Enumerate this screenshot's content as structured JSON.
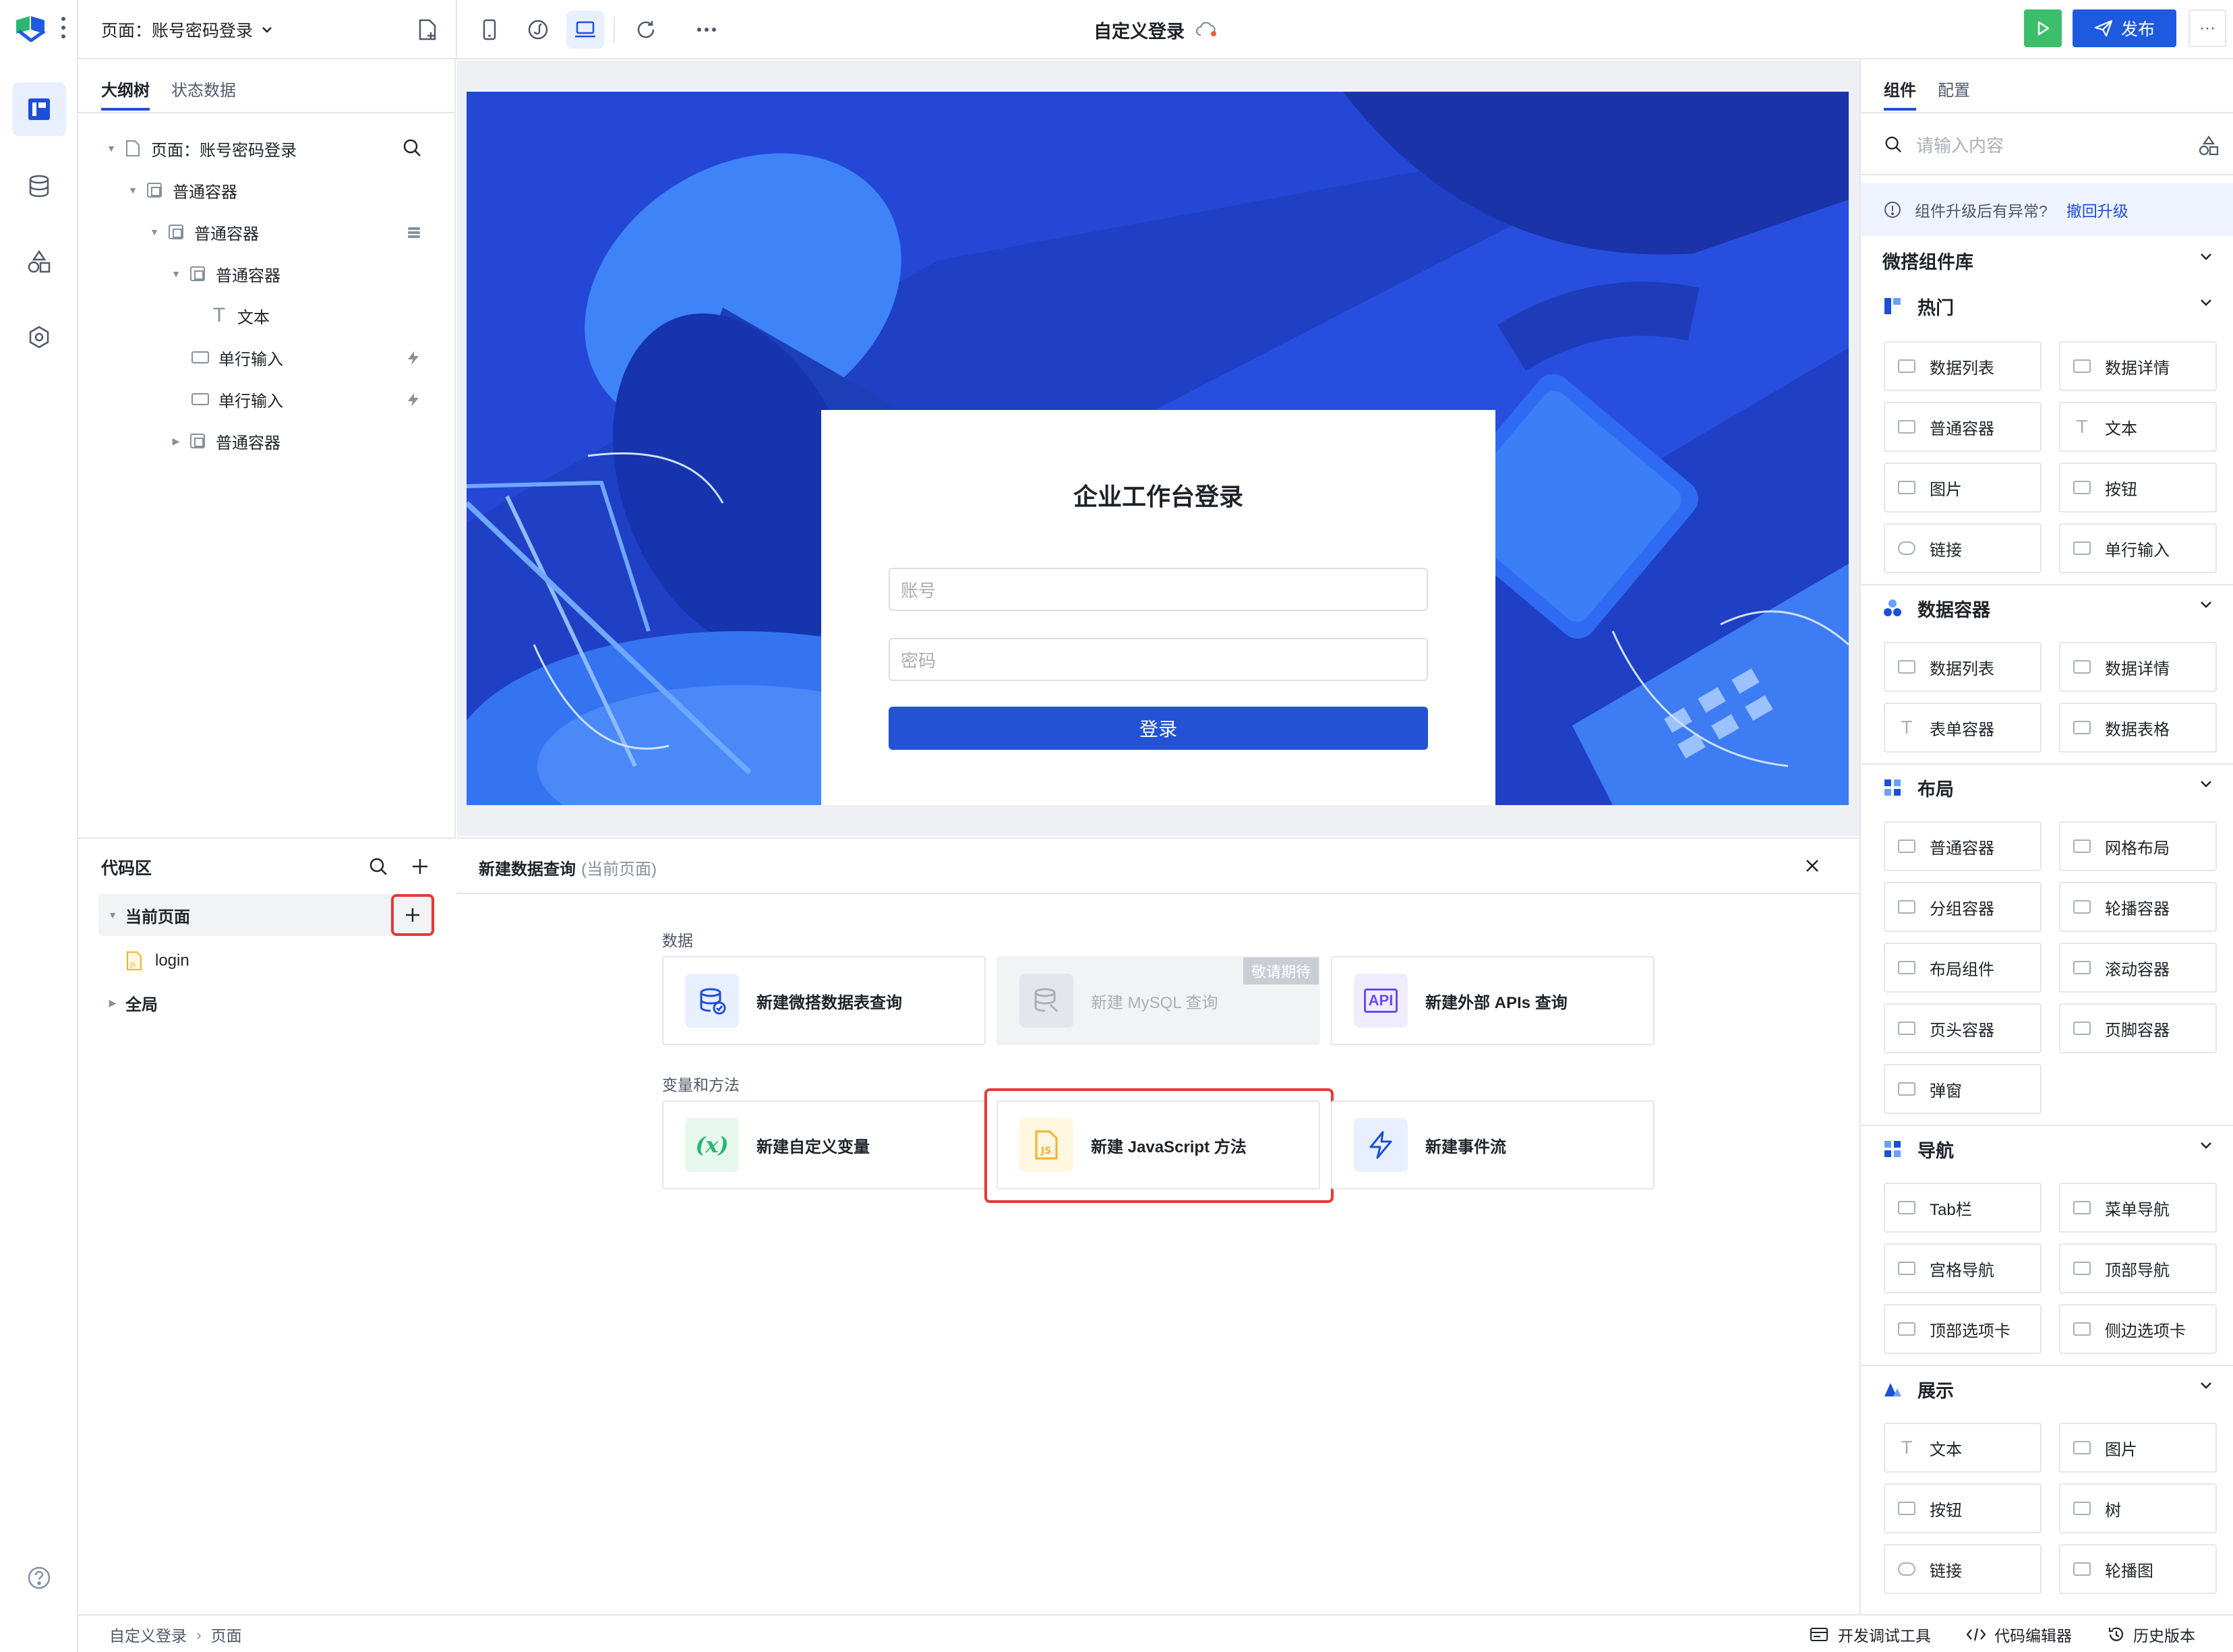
{
  "topbar": {
    "page_selector": "页面：账号密码登录",
    "app_title": "自定义登录",
    "publish_label": "发布",
    "more_label": "···"
  },
  "outline": {
    "tabs": [
      "大纲树",
      "状态数据"
    ],
    "nodes": [
      {
        "label": "页面：账号密码登录"
      },
      {
        "label": "普通容器"
      },
      {
        "label": "普通容器"
      },
      {
        "label": "普通容器"
      },
      {
        "label": "文本"
      },
      {
        "label": "单行输入"
      },
      {
        "label": "单行输入"
      },
      {
        "label": "普通容器"
      }
    ]
  },
  "code_area": {
    "title": "代码区",
    "current_page": "当前页面",
    "login_file": "login",
    "global": "全局"
  },
  "canvas": {
    "login_title": "企业工作台登录",
    "account_placeholder": "账号",
    "password_placeholder": "密码",
    "login_button": "登录"
  },
  "query_panel": {
    "title": "新建数据查询",
    "scope": "(当前页面)",
    "section_data": "数据",
    "section_vars": "变量和方法",
    "cards": {
      "weida_query": "新建微搭数据表查询",
      "mysql_query": "新建 MySQL 查询",
      "coming_soon": "敬请期待",
      "api_query": "新建外部 APIs 查询",
      "api_badge": "API",
      "custom_var": "新建自定义变量",
      "var_badge": "(x)",
      "js_method": "新建 JavaScript 方法",
      "event_flow": "新建事件流"
    }
  },
  "right_panel": {
    "tabs": [
      "组件",
      "配置"
    ],
    "search_placeholder": "请输入内容",
    "upgrade_notice": "组件升级后有异常?",
    "upgrade_link": "撤回升级",
    "library_title": "微搭组件库",
    "sections": [
      {
        "title": "热门",
        "items": [
          "数据列表",
          "数据详情",
          "普通容器",
          "文本",
          "图片",
          "按钮",
          "链接",
          "单行输入"
        ]
      },
      {
        "title": "数据容器",
        "items": [
          "数据列表",
          "数据详情",
          "表单容器",
          "数据表格"
        ]
      },
      {
        "title": "布局",
        "items": [
          "普通容器",
          "网格布局",
          "分组容器",
          "轮播容器",
          "布局组件",
          "滚动容器",
          "页头容器",
          "页脚容器",
          "弹窗"
        ]
      },
      {
        "title": "导航",
        "items": [
          "Tab栏",
          "菜单导航",
          "宫格导航",
          "顶部导航",
          "顶部选项卡",
          "侧边选项卡"
        ]
      },
      {
        "title": "展示",
        "items": [
          "文本",
          "图片",
          "按钮",
          "树",
          "链接",
          "轮播图"
        ]
      }
    ]
  },
  "statusbar": {
    "breadcrumb_app": "自定义登录",
    "breadcrumb_page": "页面",
    "devtools": "开发调试工具",
    "code_editor": "代码编辑器",
    "history": "历史版本"
  },
  "colors": {
    "accent": "#1d4ed8",
    "publish": "#1d5ae0",
    "run": "#3bbf6b",
    "highlight": "#e53935"
  }
}
